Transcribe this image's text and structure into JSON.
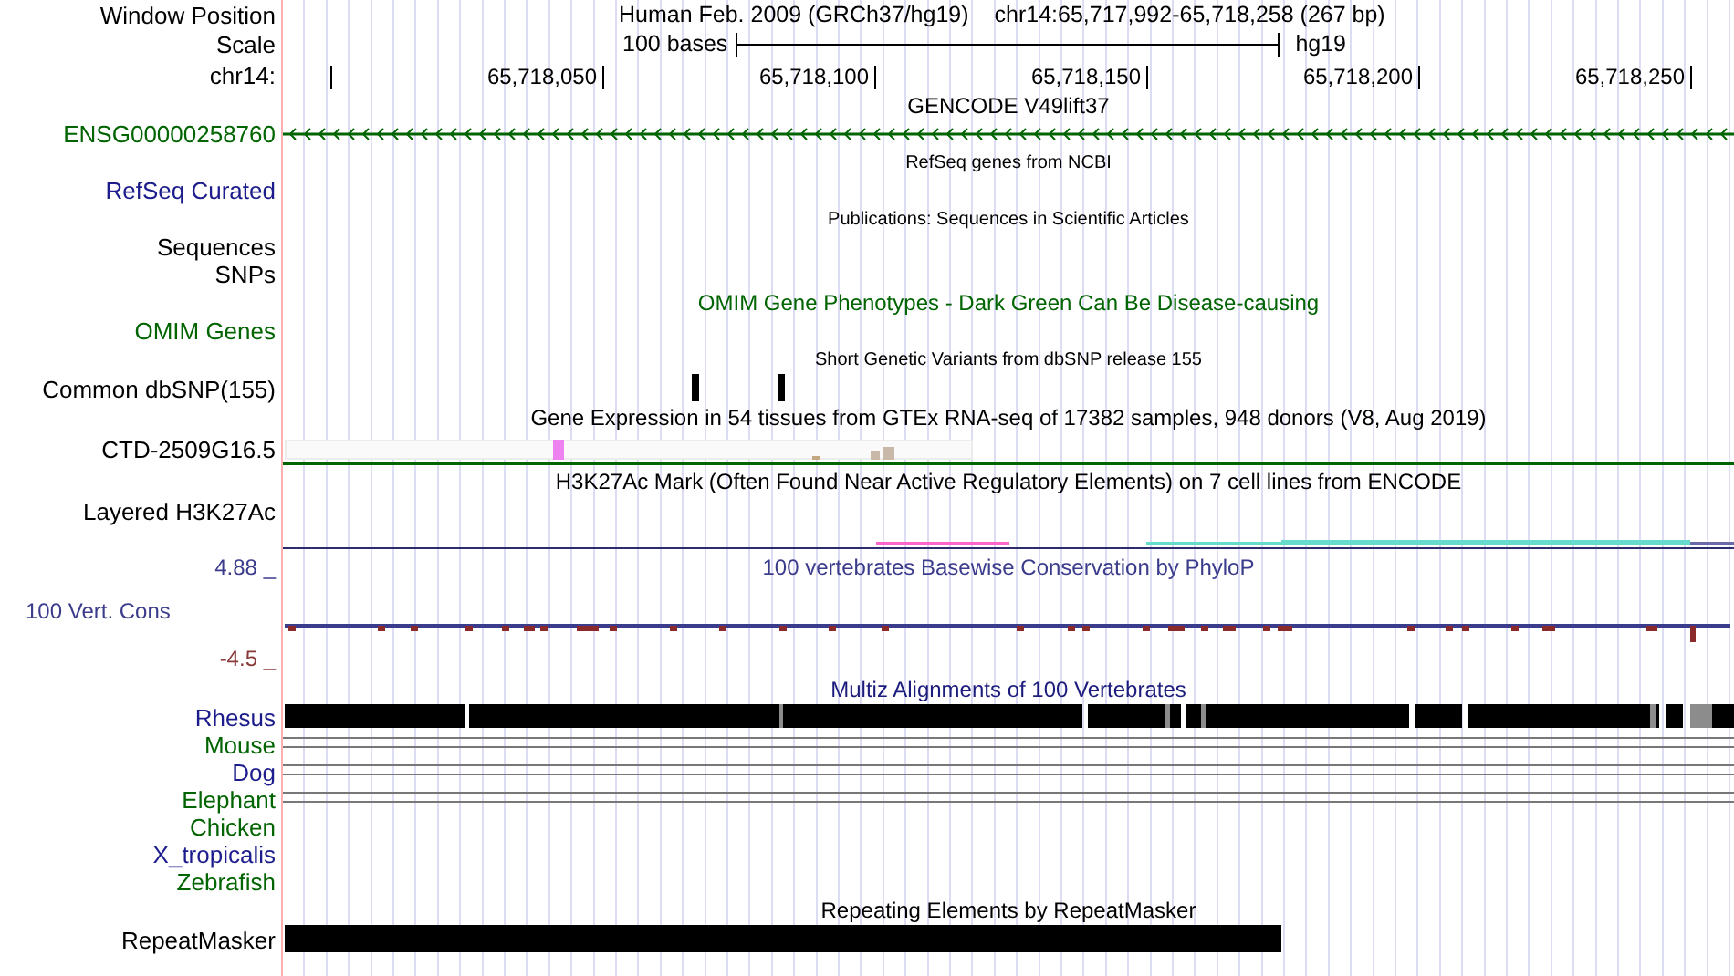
{
  "position": {
    "label": "Window Position",
    "assembly": "Human Feb. 2009 (GRCh37/hg19)",
    "range": "chr14:65,717,992-65,718,258 (267 bp)"
  },
  "scale": {
    "label": "Scale",
    "length": "100 bases",
    "db": "hg19"
  },
  "ruler": {
    "label": "chr14:",
    "ticks": [
      "65,718,050",
      "65,718,100",
      "65,718,150",
      "65,718,200",
      "65,718,250"
    ]
  },
  "tracks": [
    {
      "kind": "title",
      "text": "GENCODE V49lift37",
      "small": false,
      "color": "#000000"
    },
    {
      "kind": "gene",
      "label": "ENSG00000258760",
      "color": "#006400"
    },
    {
      "kind": "title",
      "text": "RefSeq genes from NCBI",
      "small": true,
      "color": "#000000"
    },
    {
      "kind": "label",
      "label": "RefSeq Curated",
      "color": "#1c1c8c"
    },
    {
      "kind": "title",
      "text": "Publications: Sequences in Scientific Articles",
      "small": true,
      "color": "#000000"
    },
    {
      "kind": "label",
      "label": "Sequences",
      "color": "#000000"
    },
    {
      "kind": "label",
      "label": "SNPs",
      "color": "#000000"
    },
    {
      "kind": "title",
      "text": "OMIM Gene Phenotypes - Dark Green Can Be Disease-causing",
      "small": false,
      "color": "#006400"
    },
    {
      "kind": "label",
      "label": "OMIM Genes",
      "color": "#006400"
    },
    {
      "kind": "title",
      "text": "Short Genetic Variants from dbSNP release 155",
      "small": true,
      "color": "#000000"
    },
    {
      "kind": "snp",
      "label": "Common dbSNP(155)",
      "color": "#000000"
    },
    {
      "kind": "title",
      "text": "Gene Expression in 54 tissues from GTEx RNA-seq of 17382 samples, 948 donors (V8, Aug 2019)",
      "small": false,
      "color": "#000000"
    },
    {
      "kind": "expression",
      "label": "CTD-2509G16.5",
      "color": "#000000"
    },
    {
      "kind": "title",
      "text": "H3K27Ac Mark (Often Found Near Active Regulatory Elements) on 7 cell lines from ENCODE",
      "small": false,
      "color": "#000000"
    },
    {
      "kind": "h3k27ac",
      "label": "Layered H3K27Ac",
      "color": "#000000"
    },
    {
      "kind": "phylop",
      "title": "100 vertebrates Basewise Conservation by PhyloP",
      "label": "100 Vert. Cons",
      "max": "4.88 _",
      "min": "-4.5 _",
      "color": "#3c3c8c"
    },
    {
      "kind": "title",
      "text": "Multiz Alignments of 100 Vertebrates",
      "small": false,
      "color": "#1c1c7c"
    },
    {
      "kind": "blocks",
      "label": "Rhesus",
      "color": "#1c1c8c"
    },
    {
      "kind": "lines",
      "label": "Mouse",
      "color": "#006400"
    },
    {
      "kind": "lines",
      "label": "Dog",
      "color": "#1c1c8c"
    },
    {
      "kind": "lines",
      "label": "Elephant",
      "color": "#006400"
    },
    {
      "kind": "label",
      "label": "Chicken",
      "color": "#006400"
    },
    {
      "kind": "label",
      "label": "X_tropicalis",
      "color": "#1c1c8c"
    },
    {
      "kind": "label",
      "label": "Zebrafish",
      "color": "#006400"
    },
    {
      "kind": "title",
      "text": "Repeating Elements by RepeatMasker",
      "small": false,
      "color": "#000000"
    },
    {
      "kind": "repeat",
      "label": "RepeatMasker",
      "color": "#000000"
    }
  ]
}
